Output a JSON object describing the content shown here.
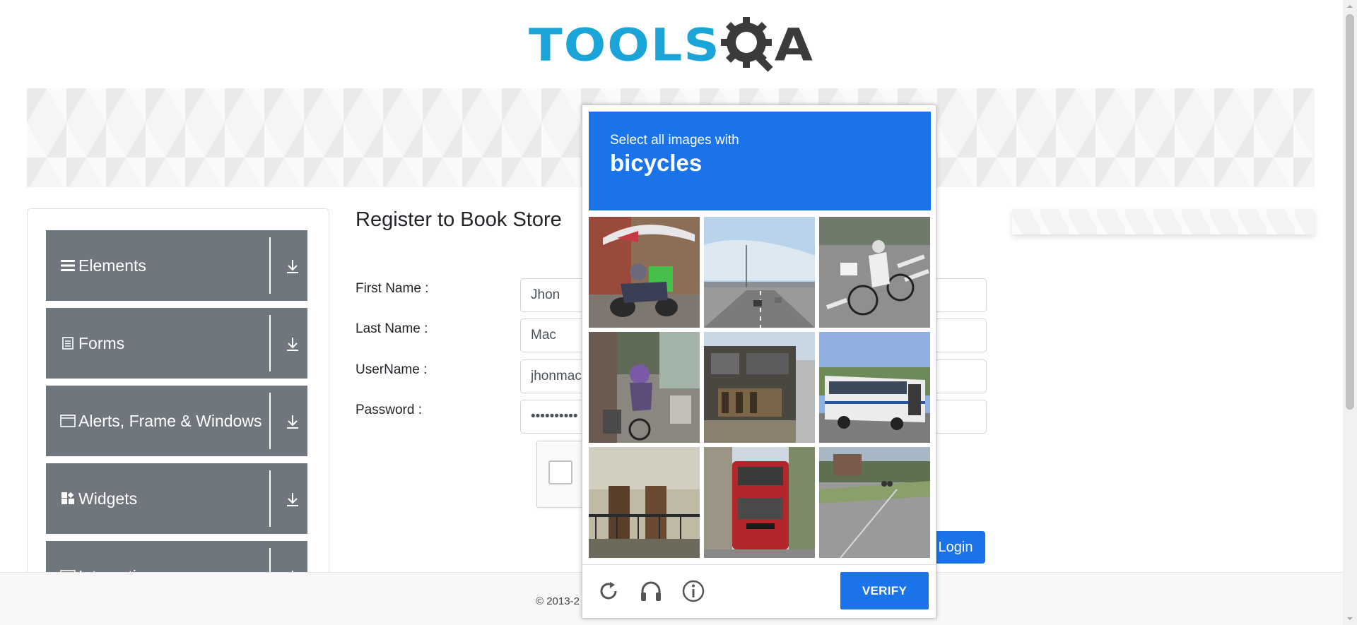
{
  "header": {
    "logo_tools": "TOOLS",
    "logo_a": "A"
  },
  "sidebar": {
    "groups": [
      {
        "label": "Elements",
        "icon": "menu-icon"
      },
      {
        "label": "Forms",
        "icon": "document-icon"
      },
      {
        "label": "Alerts, Frame & Windows",
        "icon": "window-icon"
      },
      {
        "label": "Widgets",
        "icon": "widgets-icon"
      },
      {
        "label": "Interactions",
        "icon": "interactions-icon"
      }
    ]
  },
  "main": {
    "title": "Register to Book Store",
    "fields": [
      {
        "label": "First Name :",
        "value": "Jhon"
      },
      {
        "label": "Last Name :",
        "value": "Mac"
      },
      {
        "label": "UserName :",
        "value": "jhonmac"
      },
      {
        "label": "Password :",
        "value": "••••••••••"
      }
    ],
    "login_label": "Login"
  },
  "footer": {
    "text": "© 2013-2"
  },
  "captcha": {
    "instruction": "Select all images with",
    "target": "bicycles",
    "verify_label": "VERIFY",
    "tiles": [
      "motorcycle-umbrella",
      "highway-overpass",
      "cyclist-crosswalk",
      "cyclist-street",
      "house-facade",
      "bus",
      "building-balcony",
      "red-double-decker-bus",
      "road-cyclist"
    ]
  },
  "colors": {
    "accent": "#1a73e8",
    "logo_blue": "#1aa4d8",
    "sidebar_gray": "#6f767d"
  }
}
